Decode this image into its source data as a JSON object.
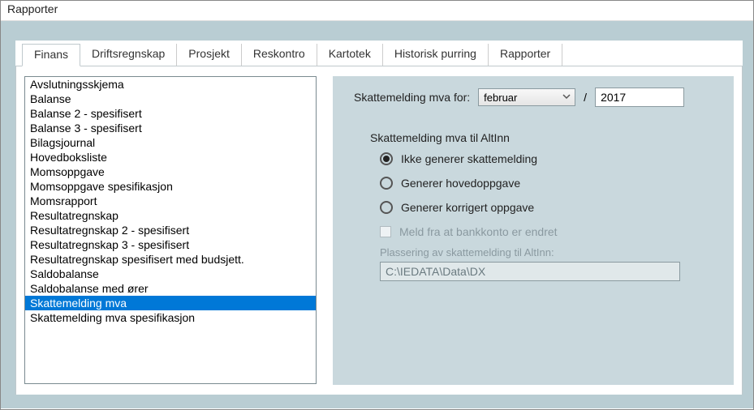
{
  "window": {
    "title": "Rapporter"
  },
  "tabs": [
    {
      "label": "Finans",
      "active": true
    },
    {
      "label": "Driftsregnskap"
    },
    {
      "label": "Prosjekt"
    },
    {
      "label": "Reskontro"
    },
    {
      "label": "Kartotek"
    },
    {
      "label": "Historisk purring"
    },
    {
      "label": "Rapporter"
    }
  ],
  "report_list": {
    "items": [
      "Avslutningsskjema",
      "Balanse",
      "Balanse 2 - spesifisert",
      "Balanse 3 - spesifisert",
      "Bilagsjournal",
      "Hovedboksliste",
      "Momsoppgave",
      "Momsoppgave spesifikasjon",
      "Momsrapport",
      "Resultatregnskap",
      "Resultatregnskap 2 - spesifisert",
      "Resultatregnskap 3 - spesifisert",
      "Resultatregnskap spesifisert med budsjett.",
      "Saldobalanse",
      "Saldobalanse med ører",
      "Skattemelding mva",
      "Skattemelding mva spesifikasjon"
    ],
    "selected_index": 15
  },
  "period": {
    "label": "Skattemelding mva for:",
    "month": "februar",
    "separator": "/",
    "year": "2017"
  },
  "altinn": {
    "group_label": "Skattemelding mva til AltInn",
    "options": [
      "Ikke generer skattemelding",
      "Generer hovedoppgave",
      "Generer korrigert oppgave"
    ],
    "selected_option": 0,
    "checkbox_label": "Meld fra at bankkonto er endret",
    "checkbox_checked": false,
    "path_label": "Plassering av skattemelding til AltInn:",
    "path_value": "C:\\IEDATA\\Data\\DX"
  }
}
